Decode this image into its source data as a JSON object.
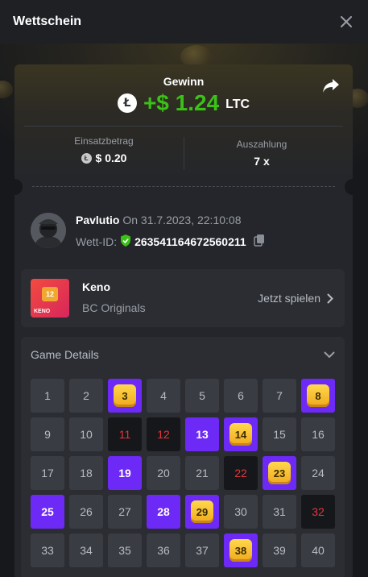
{
  "header": {
    "title": "Wettschein"
  },
  "win": {
    "label": "Gewinn",
    "amount": "+$ 1.24",
    "currency": "LTC"
  },
  "stats": {
    "stake_label": "Einsatzbetrag",
    "stake_value": "$ 0.20",
    "payout_label": "Auszahlung",
    "payout_value": "7 x"
  },
  "user": {
    "name": "Pavlutio",
    "date": "On 31.7.2023, 22:10:08",
    "bet_id_label": "Wett-ID:",
    "bet_id": "263541164672560211"
  },
  "game": {
    "name": "Keno",
    "provider": "BC Originals",
    "play_label": "Jetzt spielen",
    "thumb_number": "12",
    "thumb_label": "KENO"
  },
  "details": {
    "title": "Game Details"
  },
  "colors": {
    "accent": "#6d29f5",
    "win_green": "#3bc117",
    "miss_red": "#e6343b",
    "gem_gold": "#f0a91c"
  },
  "keno": {
    "columns": 8,
    "cells": [
      {
        "n": "1",
        "s": "normal"
      },
      {
        "n": "2",
        "s": "normal"
      },
      {
        "n": "3",
        "s": "match"
      },
      {
        "n": "4",
        "s": "normal"
      },
      {
        "n": "5",
        "s": "normal"
      },
      {
        "n": "6",
        "s": "normal"
      },
      {
        "n": "7",
        "s": "normal"
      },
      {
        "n": "8",
        "s": "match"
      },
      {
        "n": "9",
        "s": "normal"
      },
      {
        "n": "10",
        "s": "normal"
      },
      {
        "n": "11",
        "s": "miss"
      },
      {
        "n": "12",
        "s": "miss"
      },
      {
        "n": "13",
        "s": "hit"
      },
      {
        "n": "14",
        "s": "match"
      },
      {
        "n": "15",
        "s": "normal"
      },
      {
        "n": "16",
        "s": "normal"
      },
      {
        "n": "17",
        "s": "normal"
      },
      {
        "n": "18",
        "s": "normal"
      },
      {
        "n": "19",
        "s": "hit"
      },
      {
        "n": "20",
        "s": "normal"
      },
      {
        "n": "21",
        "s": "normal"
      },
      {
        "n": "22",
        "s": "miss"
      },
      {
        "n": "23",
        "s": "match"
      },
      {
        "n": "24",
        "s": "normal"
      },
      {
        "n": "25",
        "s": "hit"
      },
      {
        "n": "26",
        "s": "normal"
      },
      {
        "n": "27",
        "s": "normal"
      },
      {
        "n": "28",
        "s": "hit"
      },
      {
        "n": "29",
        "s": "match"
      },
      {
        "n": "30",
        "s": "normal"
      },
      {
        "n": "31",
        "s": "normal"
      },
      {
        "n": "32",
        "s": "miss"
      },
      {
        "n": "33",
        "s": "normal"
      },
      {
        "n": "34",
        "s": "normal"
      },
      {
        "n": "35",
        "s": "normal"
      },
      {
        "n": "36",
        "s": "normal"
      },
      {
        "n": "37",
        "s": "normal"
      },
      {
        "n": "38",
        "s": "match"
      },
      {
        "n": "39",
        "s": "normal"
      },
      {
        "n": "40",
        "s": "normal"
      }
    ]
  }
}
